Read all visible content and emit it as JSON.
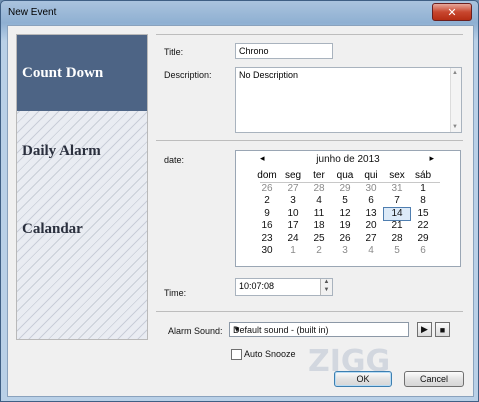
{
  "window": {
    "title": "New Event",
    "close_glyph": "✕"
  },
  "sidebar": {
    "items": [
      {
        "label": "Count Down",
        "active": true
      },
      {
        "label": "Daily Alarm",
        "active": false
      },
      {
        "label": "Calandar",
        "active": false
      }
    ]
  },
  "form": {
    "title_label": "Title:",
    "title_value": "Chrono",
    "description_label": "Description:",
    "description_value": "No Description",
    "date_label": "date:",
    "time_label": "Time:",
    "time_value": "10:07:08",
    "alarm_sound_label": "Alarm Sound:",
    "alarm_sound_value": "Default sound - (built in)",
    "auto_snooze_label": "Auto Snooze",
    "auto_snooze_checked": false
  },
  "calendar": {
    "month_label": "junho de 2013",
    "prev_glyph": "◂",
    "next_glyph": "▸",
    "weekdays": [
      "dom",
      "seg",
      "ter",
      "qua",
      "qui",
      "sex",
      "sáb"
    ],
    "weeks": [
      [
        "26",
        "27",
        "28",
        "29",
        "30",
        "31",
        "1"
      ],
      [
        "2",
        "3",
        "4",
        "5",
        "6",
        "7",
        "8"
      ],
      [
        "9",
        "10",
        "11",
        "12",
        "13",
        "14",
        "15"
      ],
      [
        "16",
        "17",
        "18",
        "19",
        "20",
        "21",
        "22"
      ],
      [
        "23",
        "24",
        "25",
        "26",
        "27",
        "28",
        "29"
      ],
      [
        "30",
        "1",
        "2",
        "3",
        "4",
        "5",
        "6"
      ]
    ],
    "today": "14",
    "accent_color": "#4f7eb0"
  },
  "buttons": {
    "play_glyph": "▶",
    "stop_glyph": "■",
    "ok_label": "OK",
    "cancel_label": "Cancel"
  },
  "colors": {
    "sidebar_active": "#4d6485",
    "titlebar": "#8fb0d2"
  }
}
